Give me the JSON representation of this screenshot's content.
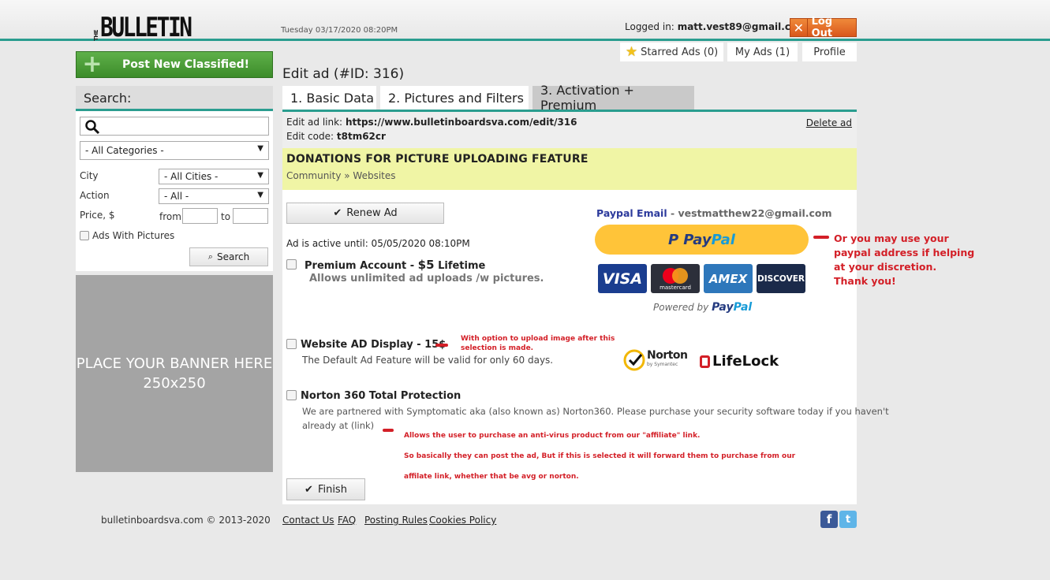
{
  "header": {
    "logo_small": "THE",
    "logo_main": "BULLETIN",
    "datetime": "Tuesday 03/17/2020 08:20PM",
    "logged_prefix": "Logged in:",
    "user_email": "matt.vest89@gmail.com",
    "logout_label": "Log Out"
  },
  "user_tabs": {
    "starred": "Starred Ads (0)",
    "my_ads": "My Ads (1)",
    "profile": "Profile"
  },
  "sidebar": {
    "post_button": "Post New Classified!",
    "search_title": "Search:",
    "search_value": "",
    "category": "- All Categories -",
    "city_label": "City",
    "city_value": "- All Cities -",
    "action_label": "Action",
    "action_value": "- All -",
    "price_label": "Price, $",
    "from_label": "from",
    "to_label": "to",
    "pictures_label": "Ads With Pictures",
    "search_button": "Search",
    "banner_line1": "PLACE YOUR BANNER HERE",
    "banner_line2": "250x250"
  },
  "main": {
    "title": "Edit ad (#ID: 316)",
    "tabs": [
      {
        "label": "1. Basic Data"
      },
      {
        "label": "2. Pictures and Filters"
      },
      {
        "label": "3. Activation + Premium"
      }
    ],
    "edit_link_label": "Edit ad link:",
    "edit_link": "https://www.bulletinboardsva.com/edit/316",
    "edit_code_label": "Edit code:",
    "edit_code": "t8tm62cr",
    "delete_label": "Delete ad",
    "ad_title": "DONATIONS FOR PICTURE UPLOADING FEATURE",
    "ad_category": "Community » Websites",
    "renew_label": "Renew Ad",
    "active_until": "Ad is active until: 05/05/2020 08:10PM",
    "premium_title": "Premium Account - ",
    "premium_price": "$5",
    "premium_suffix": " Lifetime",
    "premium_desc": "Allows unlimited ad uploads /w pictures.",
    "website_title": "Website AD Display - 15$",
    "website_desc": "The Default Ad Feature will be valid for only 60 days.",
    "website_note_1": "With option to upload image after this",
    "website_note_2": "selection is made.",
    "norton_title": "Norton 360 Total Protection",
    "norton_desc_1": "We are partnered with Symptomatic aka (also known as) Norton360. Please purchase your security software today if you haven't",
    "norton_desc_2": "already at (link)",
    "norton_note_1": "Allows the user to purchase an anti-virus product from our \"affiliate\" link.",
    "norton_note_2": "So basically they can post the ad, But if this is selected it will forward them to purchase from our",
    "norton_note_3": "affilate link, whether that be avg or norton.",
    "finish_label": "Finish",
    "paypal_email_label": "Paypal Email",
    "paypal_email": " - vestmatthew22@gmail.com",
    "paypal_pay": "Pay",
    "paypal_pal": "Pal",
    "paypal_note": [
      "Or you may use your",
      "paypal address if helping",
      "at your discretion.",
      "Thank you!"
    ],
    "cards": [
      "VISA",
      "mastercard",
      "AMEX",
      "DISCOVER"
    ],
    "powered_by": "Powered by ",
    "norton_logo": "Norton",
    "norton_logo_sub": "by Symantec",
    "lifelock_logo": "LifeLock"
  },
  "footer": {
    "copyright": "bulletinboardsva.com © 2013-2020",
    "links": [
      "Contact Us",
      "FAQ",
      "Posting Rules",
      "Cookies Policy"
    ]
  },
  "colors": {
    "accent": "#2a9d8f",
    "note_red": "#d31f27",
    "paypal_yellow": "#ffc439"
  }
}
